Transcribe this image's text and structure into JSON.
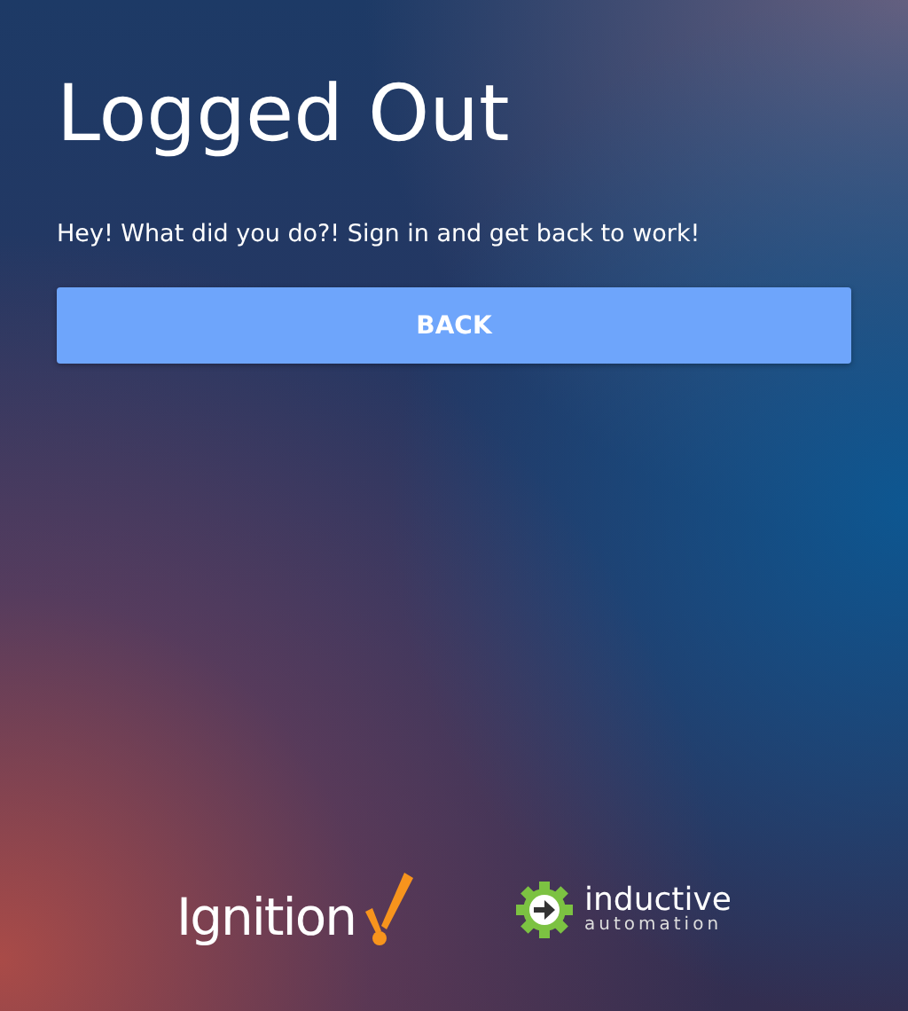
{
  "title": "Logged Out",
  "message": "Hey! What did you do?! Sign in and get back to work!",
  "button": {
    "label": "BACK"
  },
  "logos": [
    {
      "kind": "ignition",
      "text": "Ignition"
    },
    {
      "kind": "inductive",
      "text": "inductive",
      "subtext": "automation"
    }
  ]
}
